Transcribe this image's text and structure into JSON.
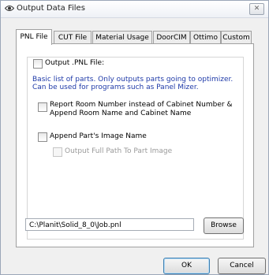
{
  "window": {
    "title": "Output Data Files",
    "close_glyph": "✕"
  },
  "tabs": [
    {
      "label": "PNL File",
      "active": true
    },
    {
      "label": "CUT File",
      "active": false
    },
    {
      "label": "Material Usage",
      "active": false
    },
    {
      "label": "DoorCIM",
      "active": false
    },
    {
      "label": "Ottimo",
      "active": false
    },
    {
      "label": "Custom",
      "active": false
    }
  ],
  "pnl": {
    "output_checkbox_label": "Output .PNL File:",
    "description_line1": "Basic list of parts.  Only outputs parts going to optimizer.",
    "description_line2": "Can be used for programs such as Panel Mizer.",
    "room_option_line1": "Report Room Number instead of Cabinet Number &",
    "room_option_line2": "Append Room Name and Cabinet Name",
    "image_option_label": "Append Part's Image Name",
    "full_path_option_label": "Output Full Path To Part Image",
    "file_path": "C:\\Planit\\Solid_8_0\\Job.pnl",
    "browse_label": "Browse"
  },
  "footer": {
    "ok_label": "OK",
    "cancel_label": "Cancel"
  },
  "colors": {
    "description_text": "#1f3aa8",
    "default_button_border": "#3c7fb1"
  },
  "icons": {
    "app": "eye-icon"
  }
}
